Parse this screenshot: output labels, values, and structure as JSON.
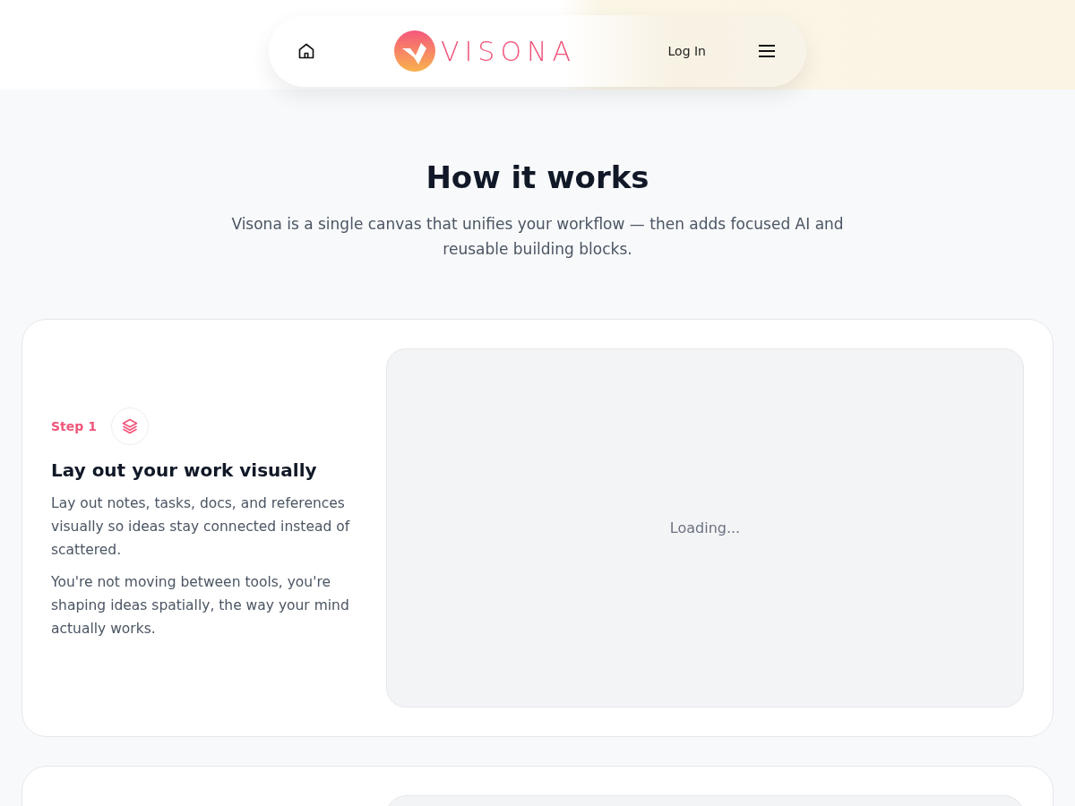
{
  "nav": {
    "logo_text": "VISONA",
    "login": "Log In"
  },
  "section": {
    "title": "How it works",
    "subtitle": "Visona is a single canvas that unifies your workflow — then adds focused AI and reusable building blocks."
  },
  "steps": [
    {
      "label": "Step 1",
      "title": "Lay out your work visually",
      "paragraphs": [
        "Lay out notes, tasks, docs, and references visually so ideas stay connected instead of scattered.",
        "You're not moving between tools, you're shaping ideas spatially, the way your mind actually works."
      ],
      "preview": "Loading..."
    }
  ]
}
